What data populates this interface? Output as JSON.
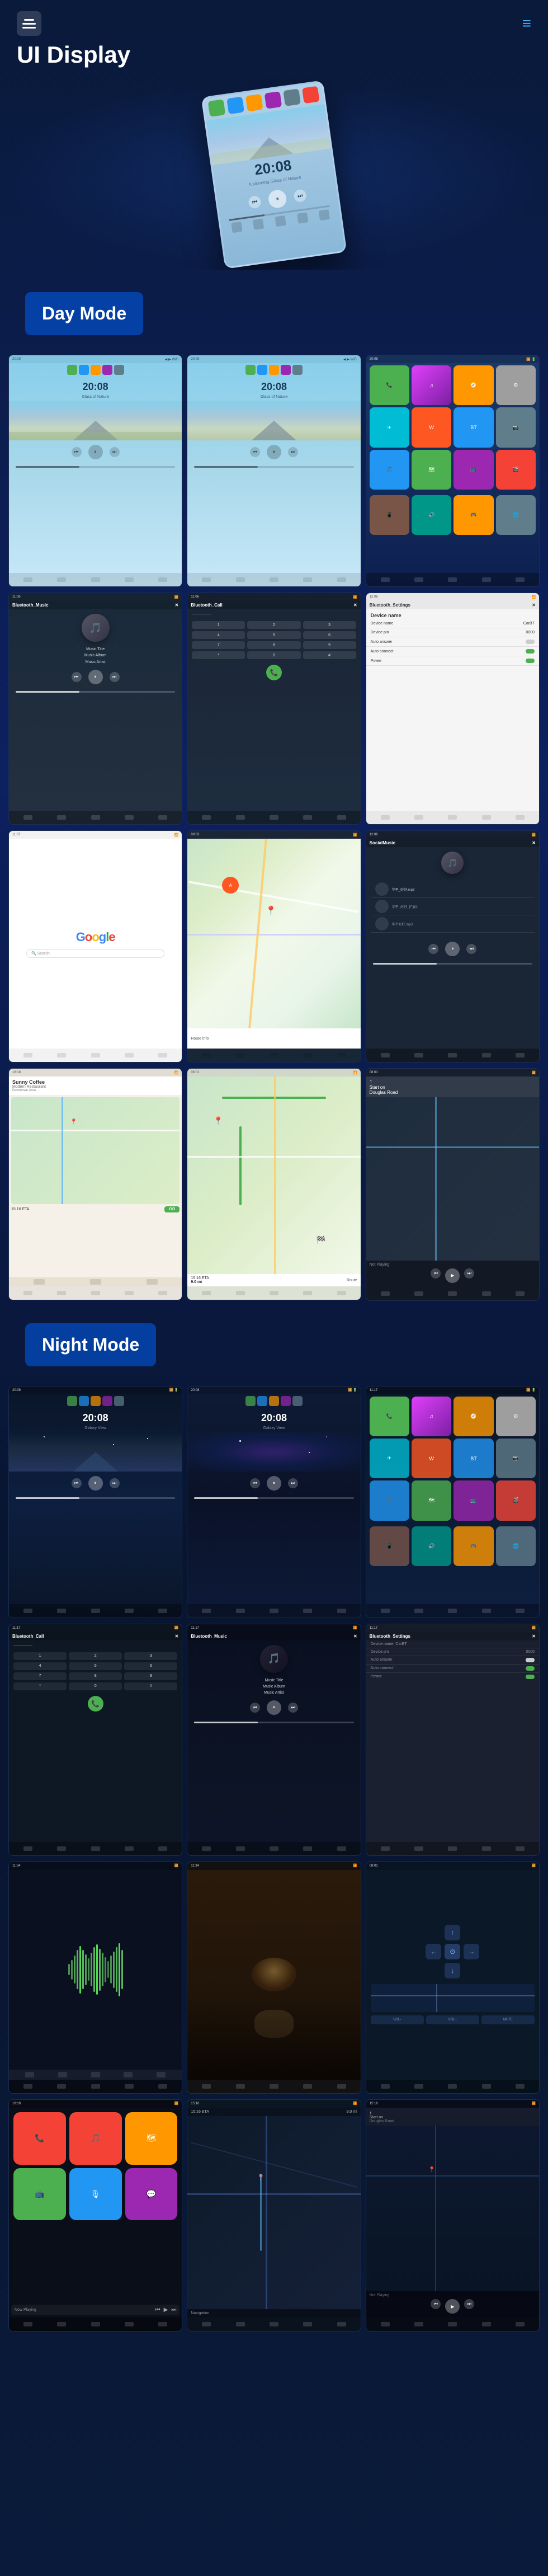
{
  "app": {
    "title": "UI Display",
    "nav_icon": "≡",
    "menu_icon": "≡"
  },
  "header": {
    "title": "UI Display",
    "hamburger_lines": 3
  },
  "hero": {
    "device_time": "20:08",
    "device_subtitle": "A stunning Glass of Nature"
  },
  "day_mode": {
    "label": "Day Mode",
    "screens": [
      {
        "type": "home",
        "time": "20:08",
        "subtitle": "Glass of Nature",
        "theme": "day"
      },
      {
        "type": "home",
        "time": "20:08",
        "subtitle": "Glass of Nature",
        "theme": "day"
      },
      {
        "type": "apps",
        "theme": "day"
      },
      {
        "type": "music",
        "title": "Bluetooth_Music",
        "track": "Music Title",
        "album": "Music Album",
        "artist": "Music Artist",
        "theme": "day"
      },
      {
        "type": "call",
        "title": "Bluetooth_Call",
        "theme": "day"
      },
      {
        "type": "settings",
        "title": "Bluetooth_Settings",
        "theme": "day"
      },
      {
        "type": "google",
        "theme": "day"
      },
      {
        "type": "maps",
        "theme": "day"
      },
      {
        "type": "social",
        "title": "SocialMusic",
        "theme": "day"
      },
      {
        "type": "carplay",
        "theme": "day"
      },
      {
        "type": "nav_map",
        "theme": "day"
      },
      {
        "type": "nav_playing",
        "theme": "day"
      }
    ]
  },
  "night_mode": {
    "label": "Night Mode",
    "screens": [
      {
        "type": "home",
        "time": "20:08",
        "subtitle": "Galaxy View",
        "theme": "night"
      },
      {
        "type": "home",
        "time": "20:08",
        "subtitle": "Galaxy View",
        "theme": "night"
      },
      {
        "type": "apps",
        "theme": "night"
      },
      {
        "type": "call",
        "title": "Bluetooth_Call",
        "theme": "night"
      },
      {
        "type": "music",
        "title": "Bluetooth_Music",
        "track": "Music Title",
        "album": "Music Album",
        "artist": "Music Artist",
        "theme": "night"
      },
      {
        "type": "settings",
        "title": "Bluetooth_Settings",
        "theme": "night"
      },
      {
        "type": "waveform",
        "theme": "night"
      },
      {
        "type": "food_video",
        "theme": "night"
      },
      {
        "type": "nav_controls",
        "theme": "night"
      },
      {
        "type": "carplay",
        "theme": "night"
      },
      {
        "type": "nav_map",
        "theme": "night"
      },
      {
        "type": "nav_playing",
        "theme": "night"
      }
    ]
  },
  "music_labels": {
    "music_album": "Music Album",
    "music_artist": "Music Artist"
  },
  "settings_fields": {
    "device_name": "Device name",
    "device_name_val": "CarBT",
    "device_pin": "Device pin",
    "device_pin_val": "0000",
    "auto_answer": "Auto answer",
    "auto_connect": "Auto connect",
    "power": "Power"
  },
  "nav": {
    "eta_label": "15:16 ETA",
    "distance_label": "9.0 mi",
    "restaurant_name": "Sunny Coffee",
    "start_on": "Start on",
    "douglas_road": "Douglas Road",
    "not_playing": "Not Playing",
    "go_label": "GO",
    "eta_val": "15:16 ETA"
  }
}
